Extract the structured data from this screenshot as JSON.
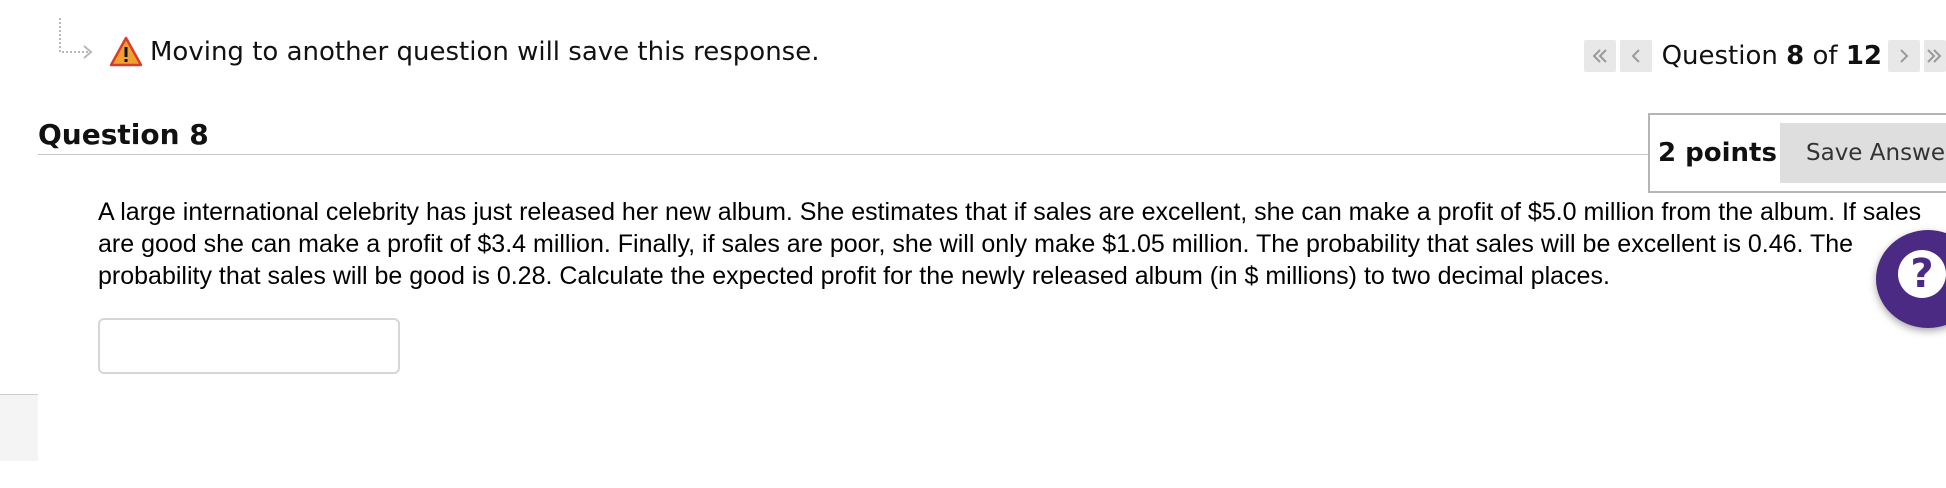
{
  "notice": {
    "text": "Moving to another question will save this response.",
    "icon": "warning-icon"
  },
  "pager": {
    "prefix": "Question ",
    "current": "8",
    "middle": " of ",
    "total": "12"
  },
  "question": {
    "title": "Question 8",
    "points": "2 points",
    "save_label": "Save Answer",
    "text": "A large international celebrity has just released her new album. She estimates that if sales are excellent, she can make a profit of $5.0 million from the album. If sales are good she can make a profit of $3.4 million. Finally, if sales are poor, she will only make $1.05 million. The probability that sales will be excellent is 0.46. The probability that sales will be good is 0.28. Calculate the expected profit for the newly released album (in $ millions) to two decimal places.",
    "answer_value": ""
  },
  "help": {
    "label": "?"
  },
  "colors": {
    "help_bubble": "#4a2a82",
    "button_bg": "#dedede",
    "warning": "#f0a030"
  }
}
